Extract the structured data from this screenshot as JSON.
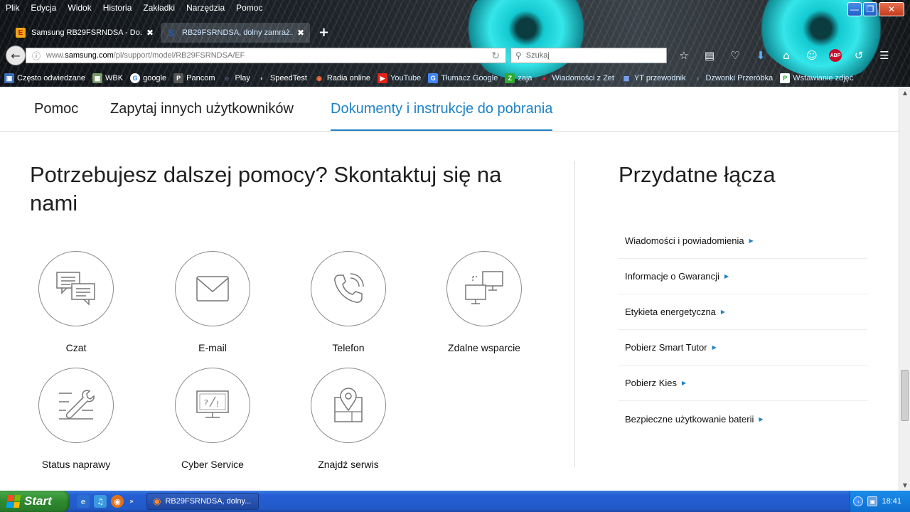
{
  "browser": {
    "menu": [
      "Plik",
      "Edycja",
      "Widok",
      "Historia",
      "Zakładki",
      "Narzędzia",
      "Pomoc"
    ],
    "tabs": [
      {
        "title": "Samsung RB29FSRNDSA - Do...",
        "favicon": "E",
        "active": false
      },
      {
        "title": "RB29FSRNDSA, dolny zamraż...",
        "favicon": "S",
        "active": true
      }
    ],
    "url_prefix": "www.",
    "url_domain": "samsung.com",
    "url_path": "/pl/support/model/RB29FSRNDSA/EF",
    "search_placeholder": "Szukaj",
    "abp_label": "ABP",
    "bookmarks": [
      "Często odwiedzane",
      "WBK",
      "google",
      "Pancom",
      "Play",
      "SpeedTest",
      "Radia online",
      "YouTube",
      "Tłumacz Google",
      "zaja",
      "Wiadomości z Zet",
      "YT przewodnik",
      "Dzwonki Przeróbka",
      "Wstawianie zdjęć"
    ]
  },
  "page": {
    "subnav": [
      "Pomoc",
      "Zapytaj innych użytkowników",
      "Dokumenty i instrukcje do pobrania"
    ],
    "contact_title": "Potrzebujesz dalszej pomocy? Skontaktuj się na nami",
    "contact_options": [
      "Czat",
      "E-mail",
      "Telefon",
      "Zdalne wsparcie",
      "Status naprawy",
      "Cyber Service",
      "Znajdź serwis"
    ],
    "links_title": "Przydatne łącza",
    "links": [
      "Wiadomości i powiadomienia",
      "Informacje o Gwarancji",
      "Etykieta energetyczna",
      "Pobierz Smart Tutor",
      "Pobierz Kies",
      "Bezpieczne użytkowanie baterii"
    ]
  },
  "taskbar": {
    "start_label": "Start",
    "task_title": "RB29FSRNDSA, dolny...",
    "clock": "18:41"
  },
  "colors": {
    "accent": "#1e82c8",
    "taskbar": "#245ed4",
    "start": "#2f8a2f"
  }
}
